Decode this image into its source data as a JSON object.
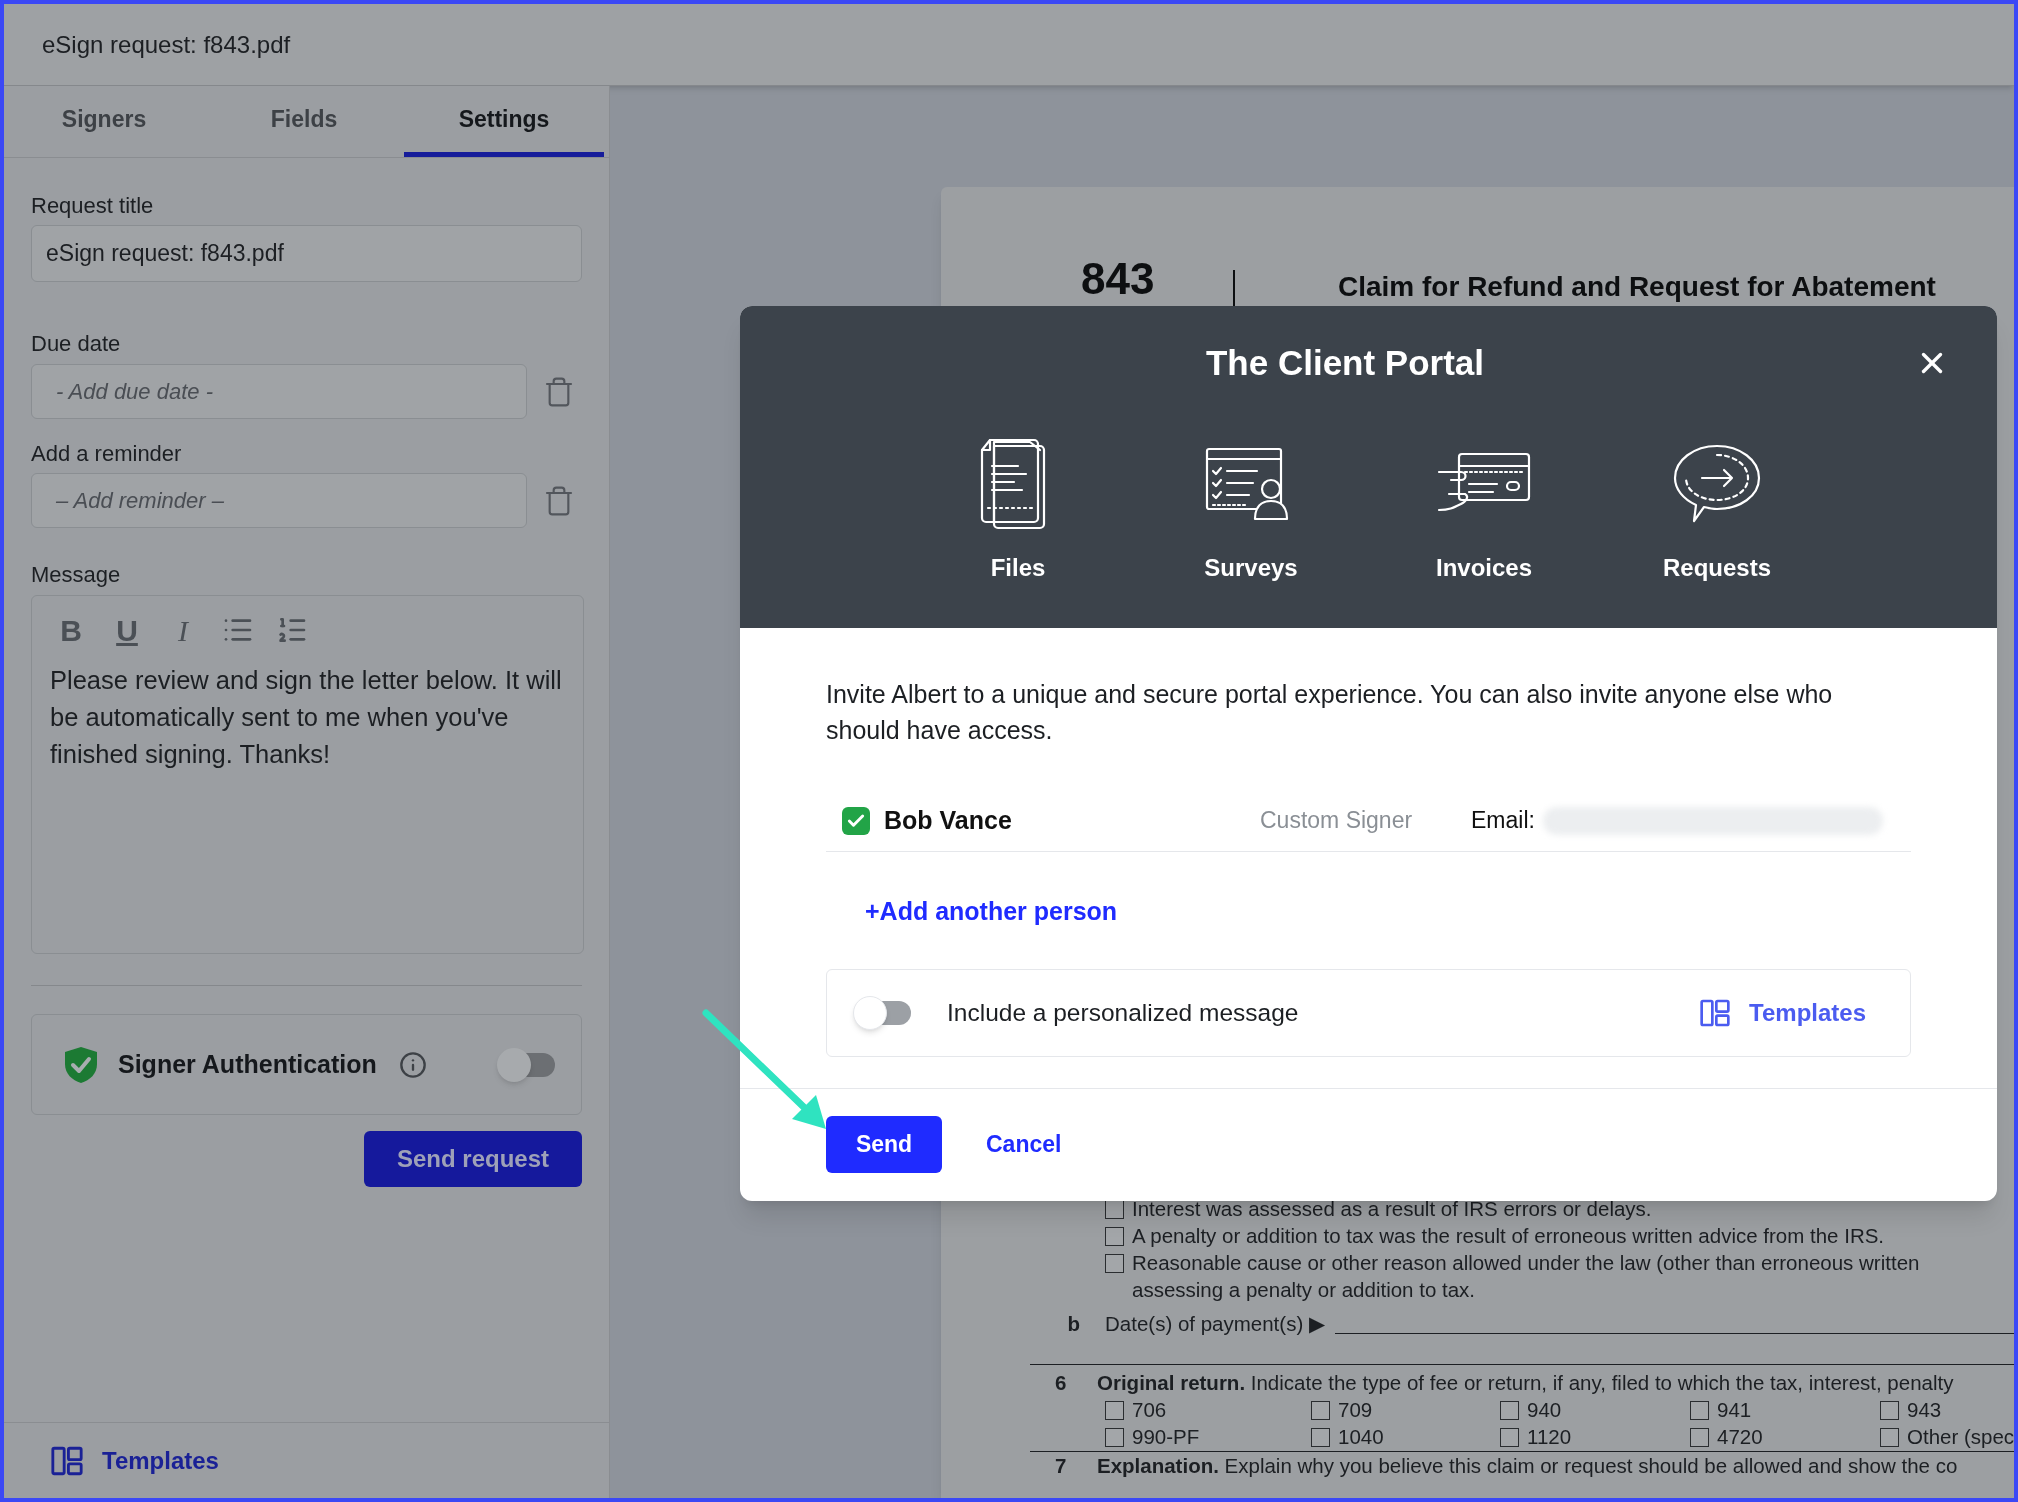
{
  "header": {
    "title": "eSign request: f843.pdf"
  },
  "tabs": [
    {
      "label": "Signers",
      "selected": false
    },
    {
      "label": "Fields",
      "selected": false
    },
    {
      "label": "Settings",
      "selected": true
    }
  ],
  "settings": {
    "request_title": {
      "label": "Request title",
      "value": "eSign request: f843.pdf"
    },
    "due_date": {
      "label": "Due date",
      "placeholder": "- Add due date -"
    },
    "reminder": {
      "label": "Add a reminder",
      "placeholder": "– Add reminder –"
    },
    "message": {
      "label": "Message",
      "toolbar": [
        {
          "kind": "bold",
          "label": "B"
        },
        {
          "kind": "underline",
          "label": "U"
        },
        {
          "kind": "italic",
          "label": "I"
        },
        {
          "kind": "bullet-list"
        },
        {
          "kind": "numbered-list"
        }
      ],
      "value": "Please review and sign the letter below. It will be automatically sent to me when you've finished signing. Thanks!"
    },
    "signer_authentication": {
      "label": "Signer Authentication",
      "on": false
    },
    "send_button": "Send request"
  },
  "sidebar_footer": {
    "templates": "Templates"
  },
  "document": {
    "form_number": "843",
    "title": "Claim for Refund and Request for Abatement",
    "reasons": [
      {
        "lines": [
          "Interest was assessed as a result of IRS errors or delays."
        ],
        "checked": false
      },
      {
        "lines": [
          "A penalty or addition to tax was the result of erroneous written advice from the IRS."
        ],
        "checked": false
      },
      {
        "lines": [
          "Reasonable cause or other reason allowed under the law (other than erroneous written",
          "assessing a penalty or addition to tax."
        ],
        "checked": false
      }
    ],
    "line_b": {
      "letter": "b",
      "label": "Date(s) of payment(s) ▶"
    },
    "line_6": {
      "number": "6",
      "text": "**Original return.** Indicate the type of fee or return, if  any, filed to which the tax, interest, penalty",
      "options": [
        {
          "label": "706",
          "checked": false
        },
        {
          "label": "709",
          "checked": false
        },
        {
          "label": "940",
          "checked": false
        },
        {
          "label": "941",
          "checked": false
        },
        {
          "label": "943",
          "checked": false
        },
        {
          "label": "990-PF",
          "checked": false
        },
        {
          "label": "1040",
          "checked": false
        },
        {
          "label": "1120",
          "checked": false
        },
        {
          "label": "4720",
          "checked": false
        },
        {
          "label": "Other (spec",
          "checked": false
        }
      ]
    },
    "line_7": {
      "number": "7",
      "text": "**Explanation.** Explain why you believe this claim or request should be allowed and show the co"
    }
  },
  "modal": {
    "title": "The Client Portal",
    "features": [
      {
        "kind": "files",
        "label": "Files"
      },
      {
        "kind": "surveys",
        "label": "Surveys"
      },
      {
        "kind": "invoices",
        "label": "Invoices"
      },
      {
        "kind": "requests",
        "label": "Requests"
      }
    ],
    "intro": "Invite Albert to a unique and secure portal experience. You can also invite anyone else who should have access.",
    "signers": [
      {
        "name": "Bob Vance",
        "checked": true,
        "role": "Custom Signer",
        "email_label": "Email:"
      }
    ],
    "add_person": "+Add another person",
    "personal_message": {
      "label": "Include a personalized message",
      "on": false
    },
    "templates": "Templates",
    "send": "Send",
    "cancel": "Cancel"
  }
}
